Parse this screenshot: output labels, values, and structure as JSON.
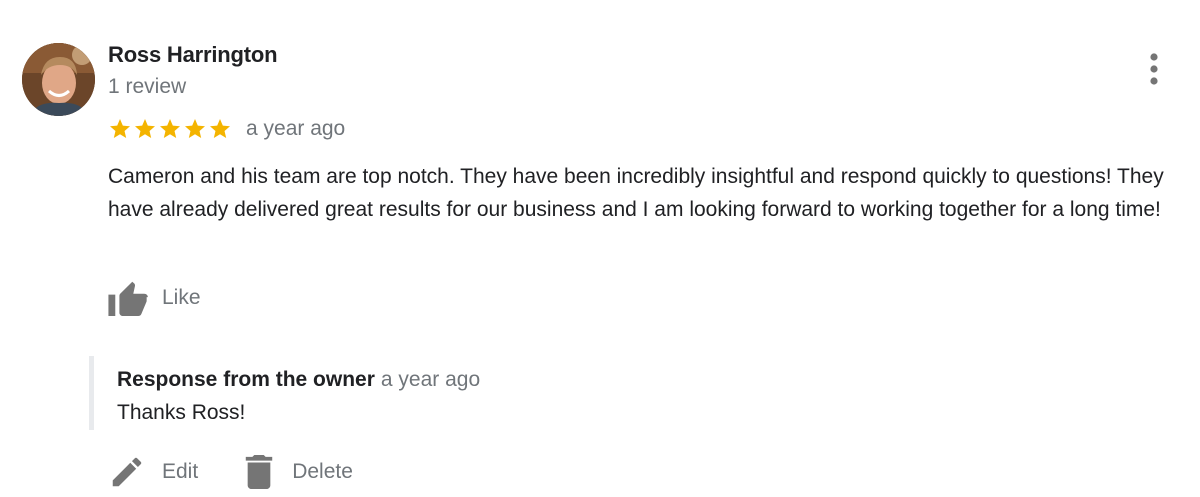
{
  "review": {
    "reviewer_name": "Ross Harrington",
    "review_count": "1 review",
    "rating": 5,
    "max_rating": 5,
    "time": "a year ago",
    "text": "Cameron and his team are top notch. They have been incredibly insightful and respond quickly to questions! They have already delivered great results for our business and I am looking forward to working together for a long time!",
    "like_label": "Like"
  },
  "owner_response": {
    "title": "Response from the owner",
    "time": "a year ago",
    "text": "Thanks Ross!"
  },
  "actions": {
    "edit_label": "Edit",
    "delete_label": "Delete"
  },
  "icons": {
    "more": "more-vert-icon",
    "like": "thumb-up-icon",
    "edit": "pencil-icon",
    "delete": "trash-icon",
    "star": "star-icon"
  },
  "colors": {
    "star": "#f4b400",
    "text": "#202124",
    "secondary": "#70757a",
    "icon": "#757575",
    "response_bar": "#e8eaed"
  }
}
